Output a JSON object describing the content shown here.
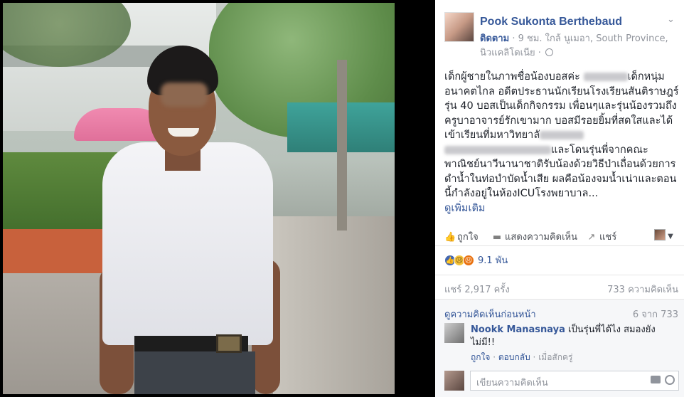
{
  "post": {
    "author": "Pook Sukonta Berthebaud",
    "follow_label": "ติดตาม",
    "meta": " · 9 ชม. ใกล้ นูเมอา, South Province, นิวแคลิโดเนีย · ",
    "body_parts": {
      "p1": "เด็กผู้ชายในภาพชื่อน้องบอสค่ะ ",
      "p2": "เด็กหนุ่มอนาคตไกล อดีตประธานนักเรียนโรงเรียนสันติราษฎร์รุ่น 40 บอสเป็นเด็กกิจกรรม เพื่อนๆและรุ่นน้องรวมถึงครูบาอาจารย์รักเขามาก บอสมีรอยยิ้มที่สดใสและได้เข้าเรียนที่มหาวิทยาลั",
      "p3": "และโดนรุ่นพี่จากคณะพาณิชย์นาวีนานาชาติรับน้องด้วยวิธีป่าเถื่อนด้วยการดำน้ำในท่อบำบัดน้ำเสีย ผลคือน้องจมน้ำเน่าและตอนนี้กำลังอยู่ในห้องICUโรงพยาบาล..."
    },
    "see_more": "ดูเพิ่มเติม"
  },
  "actions": {
    "like": "ถูกใจ",
    "comment": "แสดงความคิดเห็น",
    "share": "แชร์"
  },
  "reactions": {
    "count": "9.1 พัน"
  },
  "counts": {
    "shares": "แชร์ 2,917 ครั้ง",
    "comments": "733 ความคิดเห็น"
  },
  "comments": {
    "prev_link": "ดูความคิดเห็นก่อนหน้า",
    "prev_count": "6 จาก 733",
    "item": {
      "author": "Nookk Manasnaya",
      "text": " เป็นรุ่นพี่ได้ไง สมองยังไม่มี!!",
      "like": "ถูกใจ",
      "reply": "ตอบกลับ",
      "time": "เมื่อสักครู่"
    },
    "reply_placeholder": "เขียนความคิดเห็น"
  },
  "colors": {
    "link": "#365899",
    "meta": "#90949c",
    "text": "#1d2129"
  }
}
